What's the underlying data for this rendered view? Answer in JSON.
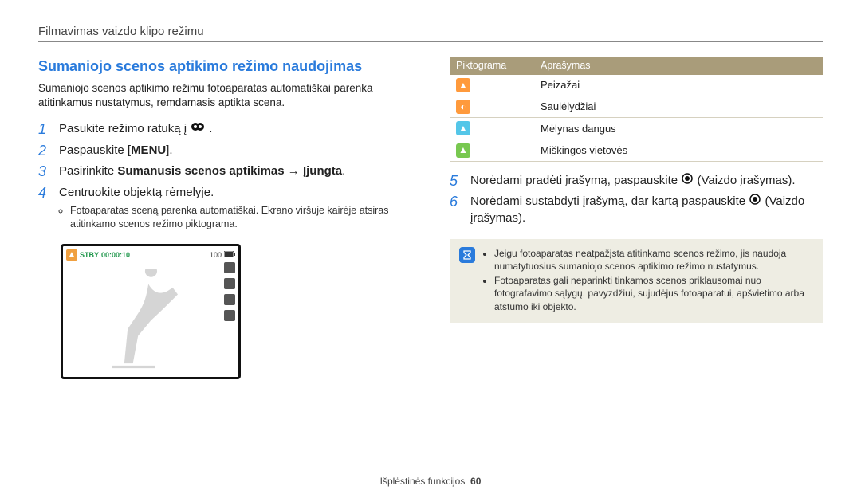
{
  "header": "Filmavimas vaizdo klipo režimu",
  "title": "Sumaniojo scenos aptikimo režimo naudojimas",
  "intro": "Sumaniojo scenos aptikimo režimu fotoaparatas automatiškai parenka atitinkamus nustatymus, remdamasis aptikta scena.",
  "steps": {
    "1": "Pasukite režimo ratuką į ",
    "2_before": "Paspauskite [",
    "2_btn": "MENU",
    "2_after": "].",
    "3_before": "Pasirinkite ",
    "3_bold": "Sumanusis scenos aptikimas → Įjungta",
    "3_after": ".",
    "4": "Centruokite objektą rėmelyje.",
    "4_sub": "Fotoaparatas sceną parenka automatiškai. Ekrano viršuje kairėje atsiras atitinkamo scenos režimo piktograma.",
    "5_before": "Norėdami pradėti įrašymą, paspauskite ",
    "5_after": " (Vaizdo įrašymas).",
    "6_before": "Norėdami sustabdyti įrašymą, dar kartą paspauskite ",
    "6_after": " (Vaizdo įrašymas)."
  },
  "screen": {
    "stby": "STBY",
    "time": "00:00:10",
    "val": "100"
  },
  "table": {
    "head1": "Piktograma",
    "head2": "Aprašymas",
    "rows": [
      {
        "icon": "landscape-icon",
        "cls": "orange",
        "glyph": "▲",
        "label": "Peizažai"
      },
      {
        "icon": "sunset-icon",
        "cls": "orange",
        "glyph": "◐",
        "label": "Saulėlydžiai"
      },
      {
        "icon": "sky-icon",
        "cls": "cyan",
        "glyph": "▲",
        "label": "Mėlynas dangus"
      },
      {
        "icon": "forest-icon",
        "cls": "green",
        "glyph": "▲",
        "label": "Miškingos vietovės"
      }
    ]
  },
  "notes": [
    "Jeigu fotoaparatas neatpažįsta atitinkamo scenos režimo, jis naudoja numatytuosius sumaniojo scenos aptikimo režimo nustatymus.",
    "Fotoaparatas gali neparinkti tinkamos scenos priklausomai nuo fotografavimo sąlygų, pavyzdžiui, sujudėjus fotoaparatui, apšvietimo arba atstumo iki objekto."
  ],
  "footer": {
    "label": "Išplėstinės funkcijos",
    "page": "60"
  }
}
